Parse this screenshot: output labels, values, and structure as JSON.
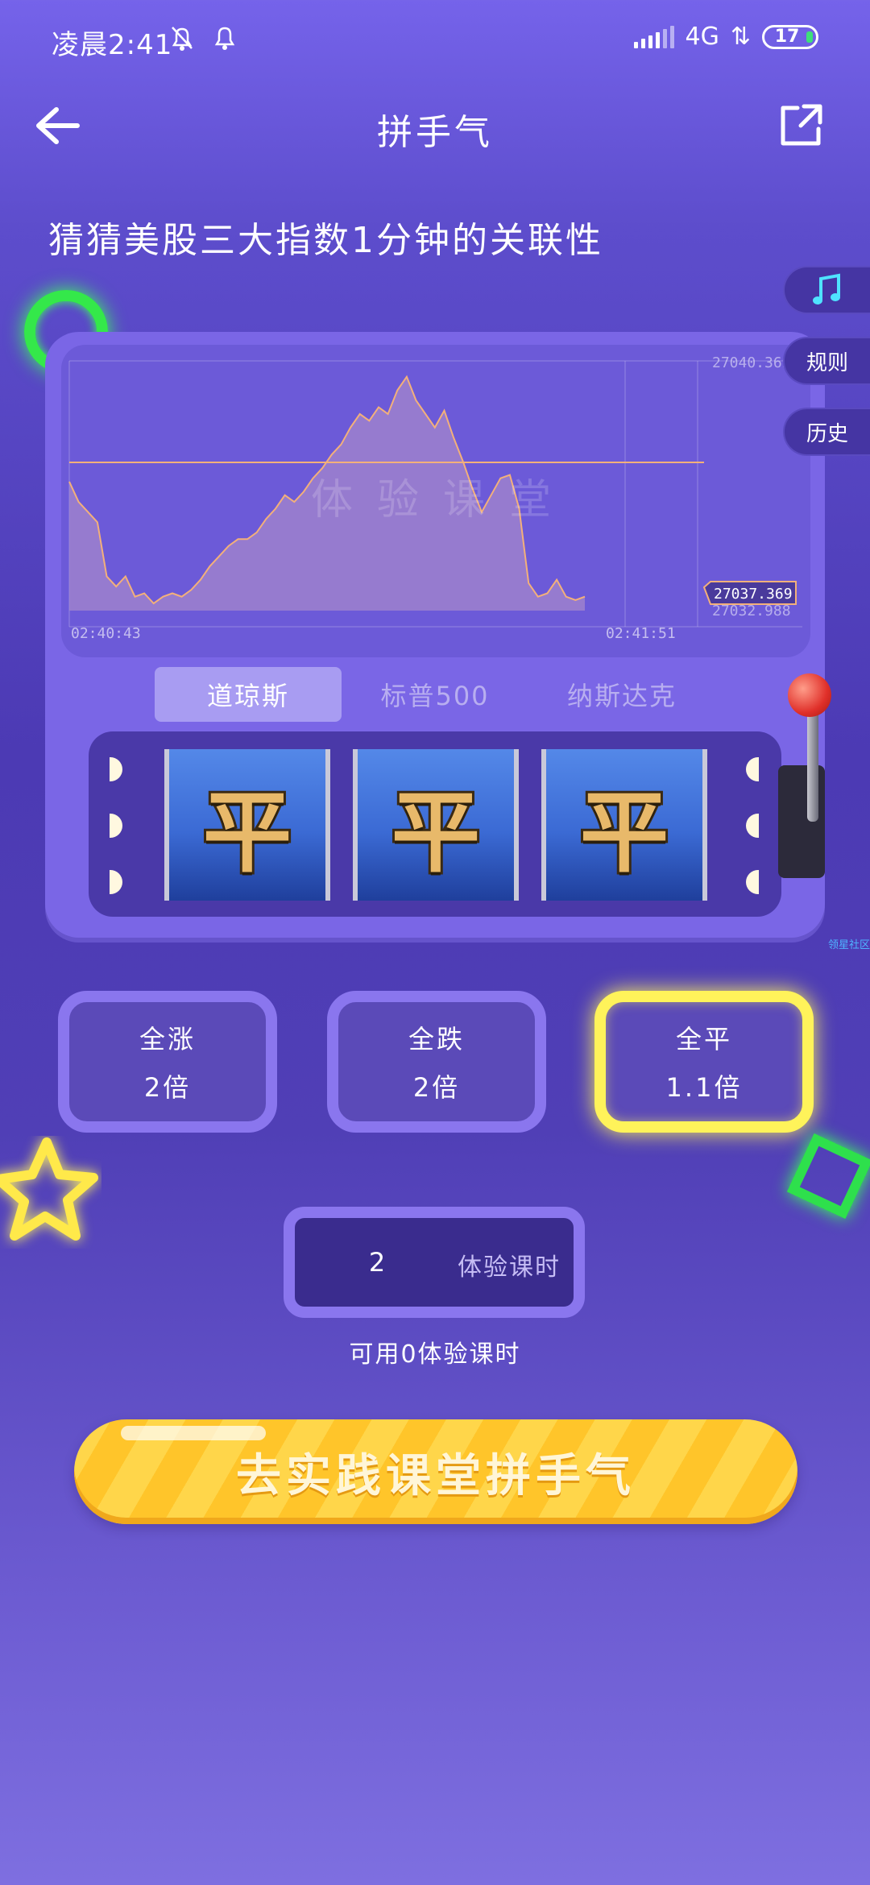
{
  "status_bar": {
    "time": "凌晨2:41",
    "network": "4G",
    "battery": "17"
  },
  "header": {
    "title": "拼手气"
  },
  "question": "猜猜美股三大指数1分钟的关联性",
  "side_tabs": {
    "rules": "规则",
    "history": "历史",
    "music_icon": "music-note-icon"
  },
  "chart": {
    "top_value": "27040.369",
    "current_value": "27037.369",
    "bottom_value": "27032.988",
    "start_time": "02:40:43",
    "end_time": "02:41:51",
    "watermark": "体验课堂",
    "line_color": "#f3b07a",
    "fill_color": "#a487cc"
  },
  "chart_data": {
    "type": "area",
    "title": "",
    "xlabel": "",
    "ylabel": "",
    "ylim": [
      27032.988,
      27040.369
    ],
    "x_range": [
      "02:40:43",
      "02:41:51"
    ],
    "reference_line": 27037.369,
    "values": [
      27036.8,
      27036.2,
      27035.9,
      27035.6,
      27034.0,
      27033.7,
      27034.0,
      27033.4,
      27033.5,
      27033.2,
      27033.4,
      27033.5,
      27033.4,
      27033.6,
      27033.9,
      27034.3,
      27034.6,
      27034.9,
      27035.1,
      27035.1,
      27035.3,
      27035.7,
      27036.0,
      27036.4,
      27036.2,
      27036.5,
      27036.9,
      27037.2,
      27037.6,
      27037.9,
      27038.4,
      27038.8,
      27038.6,
      27039.0,
      27038.8,
      27039.5,
      27039.9,
      27039.2,
      27038.8,
      27038.4,
      27038.9,
      27038.1,
      27037.4,
      27036.6,
      27035.9,
      27036.4,
      27036.9,
      27037.0,
      27036.0,
      27033.8,
      27033.4,
      27033.5,
      27033.9,
      27033.4,
      27033.3,
      27033.4
    ]
  },
  "index_tabs": [
    {
      "label": "道琼斯",
      "active": true
    },
    {
      "label": "标普500",
      "active": false
    },
    {
      "label": "纳斯达克",
      "active": false
    }
  ],
  "reels": [
    "平",
    "平",
    "平"
  ],
  "watermark_link": "领星社区",
  "options": [
    {
      "name": "全涨",
      "multiplier": "2倍",
      "selected": false
    },
    {
      "name": "全跌",
      "multiplier": "2倍",
      "selected": false
    },
    {
      "name": "全平",
      "multiplier": "1.1倍",
      "selected": true
    }
  ],
  "stake": {
    "value": "2",
    "unit": "体验课时"
  },
  "available_text": "可用0体验课时",
  "cta_label": "去实践课堂拼手气",
  "colors": {
    "accent_yellow": "#fff35a",
    "neon_green": "#34e84a",
    "panel_purple": "#7a66e6"
  }
}
